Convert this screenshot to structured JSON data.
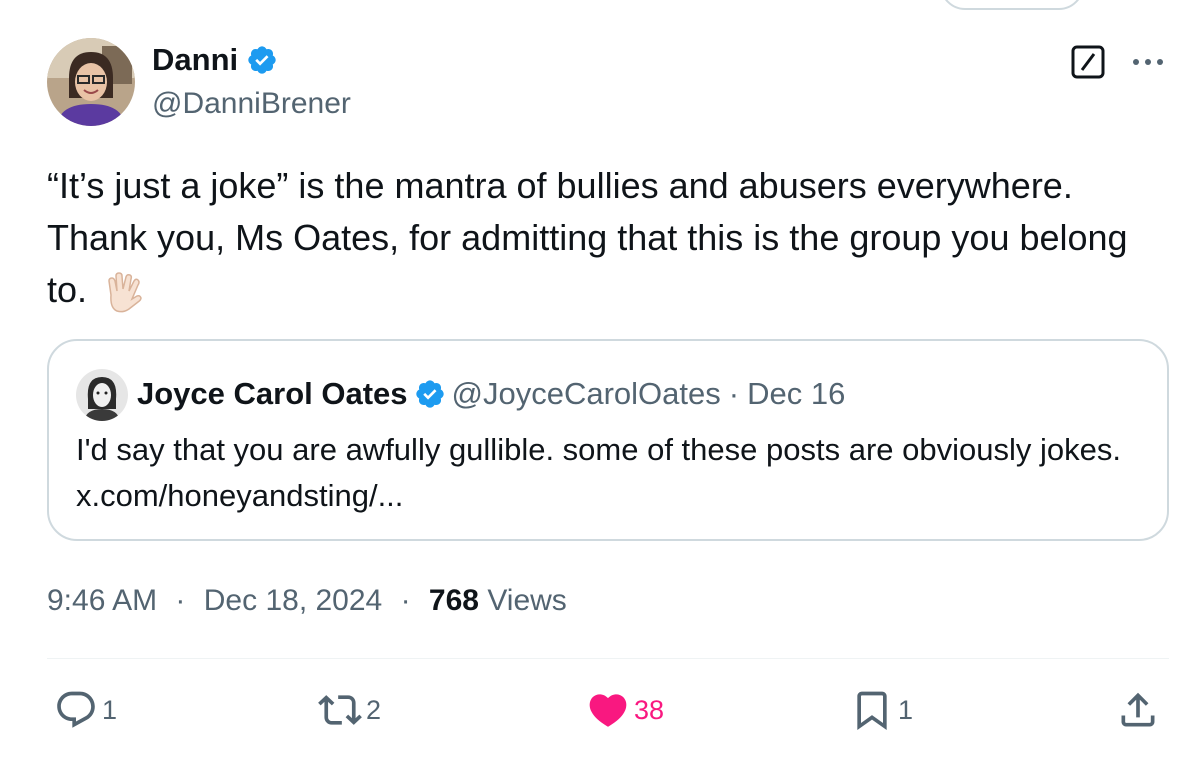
{
  "author": {
    "display_name": "Danni",
    "handle": "@DanniBrener"
  },
  "tweet": {
    "text": "“It’s just a joke” is the mantra of bullies and abusers everywhere. Thank you, Ms Oates, for admitting that this is the group you belong to.",
    "emoji_icon": "vulcan-salute-icon"
  },
  "quoted": {
    "display_name": "Joyce Carol Oates",
    "handle": "@JoyceCarolOates",
    "separator": "·",
    "date": "Dec 16",
    "text": "I'd say that you are awfully gullible.  some of these posts are obviously jokes. x.com/honeyandsting/..."
  },
  "meta": {
    "time": "9:46 AM",
    "sep1": "·",
    "date": "Dec 18, 2024",
    "sep2": "·",
    "views_count": "768",
    "views_label": "Views"
  },
  "actions": {
    "replies": "1",
    "reposts": "2",
    "likes": "38",
    "bookmarks": "1"
  },
  "colors": {
    "verified": "#1d9bf0",
    "secondary_text": "#536471",
    "like": "#f91880",
    "border": "#cfd9de"
  }
}
